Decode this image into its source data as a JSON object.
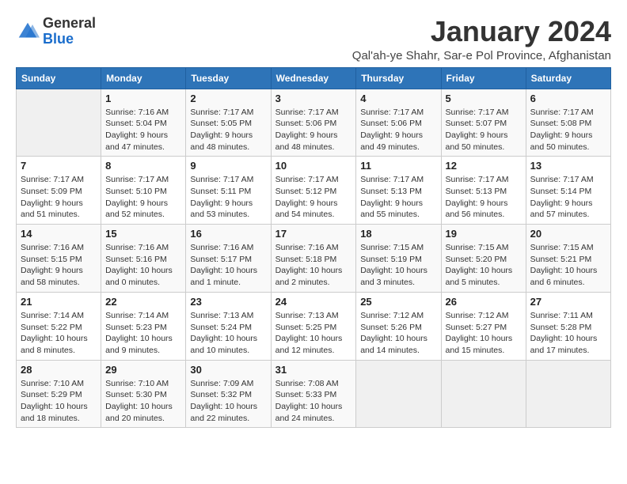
{
  "header": {
    "logo_general": "General",
    "logo_blue": "Blue",
    "title": "January 2024",
    "subtitle": "Qal'ah-ye Shahr, Sar-e Pol Province, Afghanistan"
  },
  "weekdays": [
    "Sunday",
    "Monday",
    "Tuesday",
    "Wednesday",
    "Thursday",
    "Friday",
    "Saturday"
  ],
  "weeks": [
    [
      {
        "day": "",
        "info": ""
      },
      {
        "day": "1",
        "info": "Sunrise: 7:16 AM\nSunset: 5:04 PM\nDaylight: 9 hours\nand 47 minutes."
      },
      {
        "day": "2",
        "info": "Sunrise: 7:17 AM\nSunset: 5:05 PM\nDaylight: 9 hours\nand 48 minutes."
      },
      {
        "day": "3",
        "info": "Sunrise: 7:17 AM\nSunset: 5:06 PM\nDaylight: 9 hours\nand 48 minutes."
      },
      {
        "day": "4",
        "info": "Sunrise: 7:17 AM\nSunset: 5:06 PM\nDaylight: 9 hours\nand 49 minutes."
      },
      {
        "day": "5",
        "info": "Sunrise: 7:17 AM\nSunset: 5:07 PM\nDaylight: 9 hours\nand 50 minutes."
      },
      {
        "day": "6",
        "info": "Sunrise: 7:17 AM\nSunset: 5:08 PM\nDaylight: 9 hours\nand 50 minutes."
      }
    ],
    [
      {
        "day": "7",
        "info": "Sunrise: 7:17 AM\nSunset: 5:09 PM\nDaylight: 9 hours\nand 51 minutes."
      },
      {
        "day": "8",
        "info": "Sunrise: 7:17 AM\nSunset: 5:10 PM\nDaylight: 9 hours\nand 52 minutes."
      },
      {
        "day": "9",
        "info": "Sunrise: 7:17 AM\nSunset: 5:11 PM\nDaylight: 9 hours\nand 53 minutes."
      },
      {
        "day": "10",
        "info": "Sunrise: 7:17 AM\nSunset: 5:12 PM\nDaylight: 9 hours\nand 54 minutes."
      },
      {
        "day": "11",
        "info": "Sunrise: 7:17 AM\nSunset: 5:13 PM\nDaylight: 9 hours\nand 55 minutes."
      },
      {
        "day": "12",
        "info": "Sunrise: 7:17 AM\nSunset: 5:13 PM\nDaylight: 9 hours\nand 56 minutes."
      },
      {
        "day": "13",
        "info": "Sunrise: 7:17 AM\nSunset: 5:14 PM\nDaylight: 9 hours\nand 57 minutes."
      }
    ],
    [
      {
        "day": "14",
        "info": "Sunrise: 7:16 AM\nSunset: 5:15 PM\nDaylight: 9 hours\nand 58 minutes."
      },
      {
        "day": "15",
        "info": "Sunrise: 7:16 AM\nSunset: 5:16 PM\nDaylight: 10 hours\nand 0 minutes."
      },
      {
        "day": "16",
        "info": "Sunrise: 7:16 AM\nSunset: 5:17 PM\nDaylight: 10 hours\nand 1 minute."
      },
      {
        "day": "17",
        "info": "Sunrise: 7:16 AM\nSunset: 5:18 PM\nDaylight: 10 hours\nand 2 minutes."
      },
      {
        "day": "18",
        "info": "Sunrise: 7:15 AM\nSunset: 5:19 PM\nDaylight: 10 hours\nand 3 minutes."
      },
      {
        "day": "19",
        "info": "Sunrise: 7:15 AM\nSunset: 5:20 PM\nDaylight: 10 hours\nand 5 minutes."
      },
      {
        "day": "20",
        "info": "Sunrise: 7:15 AM\nSunset: 5:21 PM\nDaylight: 10 hours\nand 6 minutes."
      }
    ],
    [
      {
        "day": "21",
        "info": "Sunrise: 7:14 AM\nSunset: 5:22 PM\nDaylight: 10 hours\nand 8 minutes."
      },
      {
        "day": "22",
        "info": "Sunrise: 7:14 AM\nSunset: 5:23 PM\nDaylight: 10 hours\nand 9 minutes."
      },
      {
        "day": "23",
        "info": "Sunrise: 7:13 AM\nSunset: 5:24 PM\nDaylight: 10 hours\nand 10 minutes."
      },
      {
        "day": "24",
        "info": "Sunrise: 7:13 AM\nSunset: 5:25 PM\nDaylight: 10 hours\nand 12 minutes."
      },
      {
        "day": "25",
        "info": "Sunrise: 7:12 AM\nSunset: 5:26 PM\nDaylight: 10 hours\nand 14 minutes."
      },
      {
        "day": "26",
        "info": "Sunrise: 7:12 AM\nSunset: 5:27 PM\nDaylight: 10 hours\nand 15 minutes."
      },
      {
        "day": "27",
        "info": "Sunrise: 7:11 AM\nSunset: 5:28 PM\nDaylight: 10 hours\nand 17 minutes."
      }
    ],
    [
      {
        "day": "28",
        "info": "Sunrise: 7:10 AM\nSunset: 5:29 PM\nDaylight: 10 hours\nand 18 minutes."
      },
      {
        "day": "29",
        "info": "Sunrise: 7:10 AM\nSunset: 5:30 PM\nDaylight: 10 hours\nand 20 minutes."
      },
      {
        "day": "30",
        "info": "Sunrise: 7:09 AM\nSunset: 5:32 PM\nDaylight: 10 hours\nand 22 minutes."
      },
      {
        "day": "31",
        "info": "Sunrise: 7:08 AM\nSunset: 5:33 PM\nDaylight: 10 hours\nand 24 minutes."
      },
      {
        "day": "",
        "info": ""
      },
      {
        "day": "",
        "info": ""
      },
      {
        "day": "",
        "info": ""
      }
    ]
  ]
}
